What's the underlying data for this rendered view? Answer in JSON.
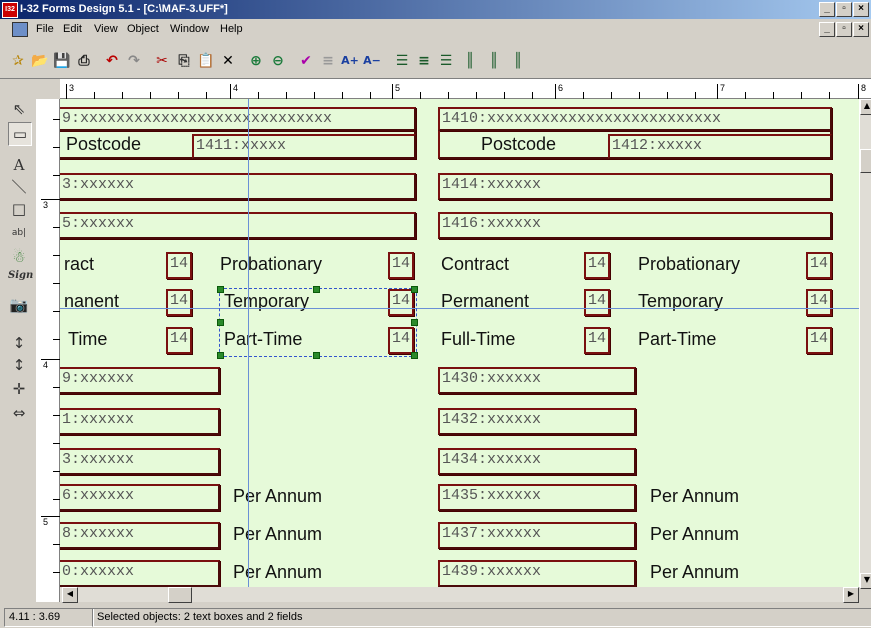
{
  "window": {
    "title": "I-32 Forms Design 5.1 - [C:\\MAF-3.UFF*]",
    "app_icon_text": "I32"
  },
  "menu": [
    "File",
    "Edit",
    "View",
    "Object",
    "Window",
    "Help"
  ],
  "toolbar_icons": [
    "new-icon",
    "open-icon",
    "save-icon",
    "print-icon",
    "undo-icon",
    "redo-icon",
    "cut-icon",
    "copy-icon",
    "paste-icon",
    "delete-icon",
    "zoom-in-icon",
    "zoom-out-icon",
    "spellcheck-icon",
    "text-property-icon",
    "font-larger-icon",
    "font-smaller-icon",
    "align-left-icon",
    "align-center-icon",
    "align-right-icon",
    "align-top-icon",
    "align-middle-icon",
    "align-bottom-icon"
  ],
  "toolbar_glyphs": [
    "✰",
    "📂",
    "💾",
    "⎙",
    "↶",
    "↷",
    "✂",
    "⎘",
    "📋",
    "✕",
    "⊕",
    "⊖",
    "✔",
    "≡",
    "A+",
    "A−",
    "☰",
    "≡",
    "☰",
    "║",
    "║",
    "║"
  ],
  "toolbox_icons": [
    "pointer-icon",
    "rectangle-select-icon",
    "text-tool-icon",
    "line-tool-icon",
    "box-tool-icon",
    "field-tool-icon",
    "image-tool-icon",
    "signature-tool-icon",
    "camera-tool-icon",
    "move-tool-icon",
    "size-tool-icon",
    "align-tool-icon",
    "space-tool-icon"
  ],
  "toolbox_glyphs": [
    "⇖",
    "▭",
    "A",
    "＼",
    "□",
    "ab|",
    "☃",
    "Sign",
    "📷",
    "↕",
    "↕",
    "✛",
    "⇔"
  ],
  "ruler": {
    "h_labels": [
      "3",
      "4",
      "5",
      "6",
      "7",
      "8"
    ],
    "v_labels": [
      "3",
      "4",
      "5"
    ]
  },
  "form": {
    "fields_left": [
      "9:xxxxxxxxxxxxxxxxxxxxxxxxxxxx",
      "3:xxxxxx",
      "5:xxxxxx",
      "9:xxxxxx",
      "1:xxxxxx",
      "3:xxxxxx",
      "6:xxxxxx",
      "8:xxxxxx",
      "0:xxxxxx"
    ],
    "fields_right": [
      "1410:xxxxxxxxxxxxxxxxxxxxxxxxxx",
      "1414:xxxxxx",
      "1416:xxxxxx",
      "1430:xxxxxx",
      "1432:xxxxxx",
      "1434:xxxxxx",
      "1435:xxxxxx",
      "1437:xxxxxx",
      "1439:xxxxxx"
    ],
    "postcode_label_left": "Postcode",
    "postcode_field_left": "1411:xxxxx",
    "postcode_label_right": "Postcode",
    "postcode_field_right": "1412:xxxxx",
    "employment_left": [
      "ract",
      "nanent",
      "Time"
    ],
    "employment_mid": [
      "Probationary",
      "Temporary",
      "Part-Time"
    ],
    "employment_right_a": [
      "Contract",
      "Permanent",
      "Full-Time"
    ],
    "employment_right_b": [
      "Probationary",
      "Temporary",
      "Part-Time"
    ],
    "checkbox_code": "14",
    "per_annum": "Per Annum"
  },
  "status": {
    "coords": "4.11 : 3.69",
    "message": "Selected objects:  2 text boxes and 2 fields"
  },
  "colors": {
    "canvas": "#e6fad9",
    "field_border": "#7a1010",
    "guide": "#6a8fd6",
    "title_start": "#0a246a"
  }
}
